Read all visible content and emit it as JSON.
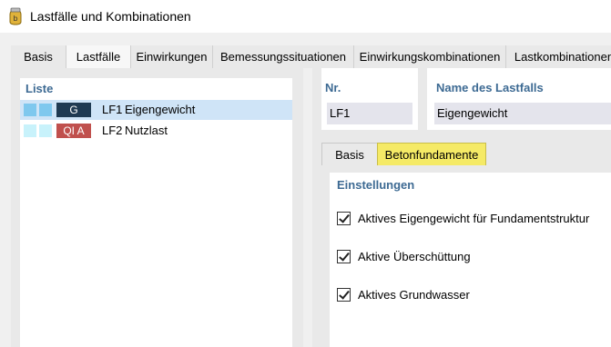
{
  "window": {
    "title": "Lastfälle und Kombinationen"
  },
  "tabs": [
    {
      "label": "Basis"
    },
    {
      "label": "Lastfälle"
    },
    {
      "label": "Einwirkungen"
    },
    {
      "label": "Bemessungssituationen"
    },
    {
      "label": "Einwirkungskombinationen"
    },
    {
      "label": "Lastkombinationen"
    }
  ],
  "active_tab": "Lastfälle",
  "list": {
    "header": "Liste",
    "rows": [
      {
        "tag": "G",
        "tag_color": "#1f3a52",
        "square_color": "#7fc8ee",
        "id": "LF1",
        "name": "Eigengewicht",
        "selected": true
      },
      {
        "tag": "QI A",
        "tag_color": "#c0504d",
        "square_color": "#c8f2fb",
        "id": "LF2",
        "name": "Nutzlast",
        "selected": false
      }
    ]
  },
  "fields": {
    "nr_label": "Nr.",
    "nr_value": "LF1",
    "name_label": "Name des Lastfalls",
    "name_value": "Eigengewicht"
  },
  "subtabs": [
    {
      "label": "Basis"
    },
    {
      "label": "Betonfundamente"
    }
  ],
  "active_subtab": "Betonfundamente",
  "settings": {
    "title": "Einstellungen",
    "options": [
      {
        "label": "Aktives Eigengewicht für Fundamentstruktur",
        "checked": true
      },
      {
        "label": "Aktive Überschüttung",
        "checked": true
      },
      {
        "label": "Aktives Grundwasser",
        "checked": true
      }
    ]
  },
  "colors": {
    "accent_text": "#3d6a93",
    "highlight_tab": "#f5ea66",
    "selection": "#cfe4f7"
  }
}
